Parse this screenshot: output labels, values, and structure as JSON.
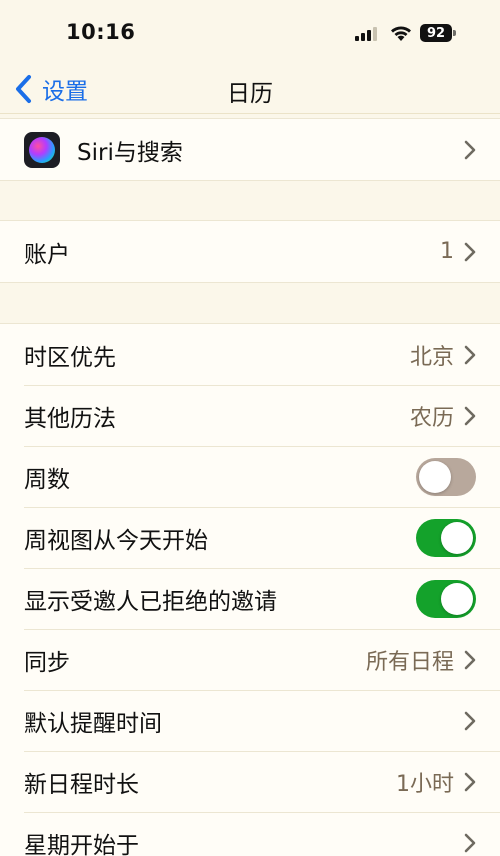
{
  "status": {
    "time": "10:16",
    "battery": "92"
  },
  "nav": {
    "back_label": "设置",
    "title": "日历"
  },
  "groups": {
    "siri": {
      "label": "Siri与搜索"
    },
    "account": {
      "label": "账户",
      "value": "1"
    },
    "settings": {
      "timezone": {
        "label": "时区优先",
        "value": "北京"
      },
      "alt_calendar": {
        "label": "其他历法",
        "value": "农历"
      },
      "week_numbers": {
        "label": "周数",
        "on": false
      },
      "week_view_today": {
        "label": "周视图从今天开始",
        "on": true
      },
      "declined_invites": {
        "label": "显示受邀人已拒绝的邀请",
        "on": true
      },
      "sync": {
        "label": "同步",
        "value": "所有日程"
      },
      "default_alert": {
        "label": "默认提醒时间"
      },
      "event_duration": {
        "label": "新日程时长",
        "value": "1小时"
      },
      "week_start": {
        "label": "星期开始于"
      }
    }
  },
  "colors": {
    "accent": "#1a6ee8",
    "toggle_on": "#14a22b",
    "toggle_off": "#b8a89c",
    "background": "#fbf7ea"
  }
}
